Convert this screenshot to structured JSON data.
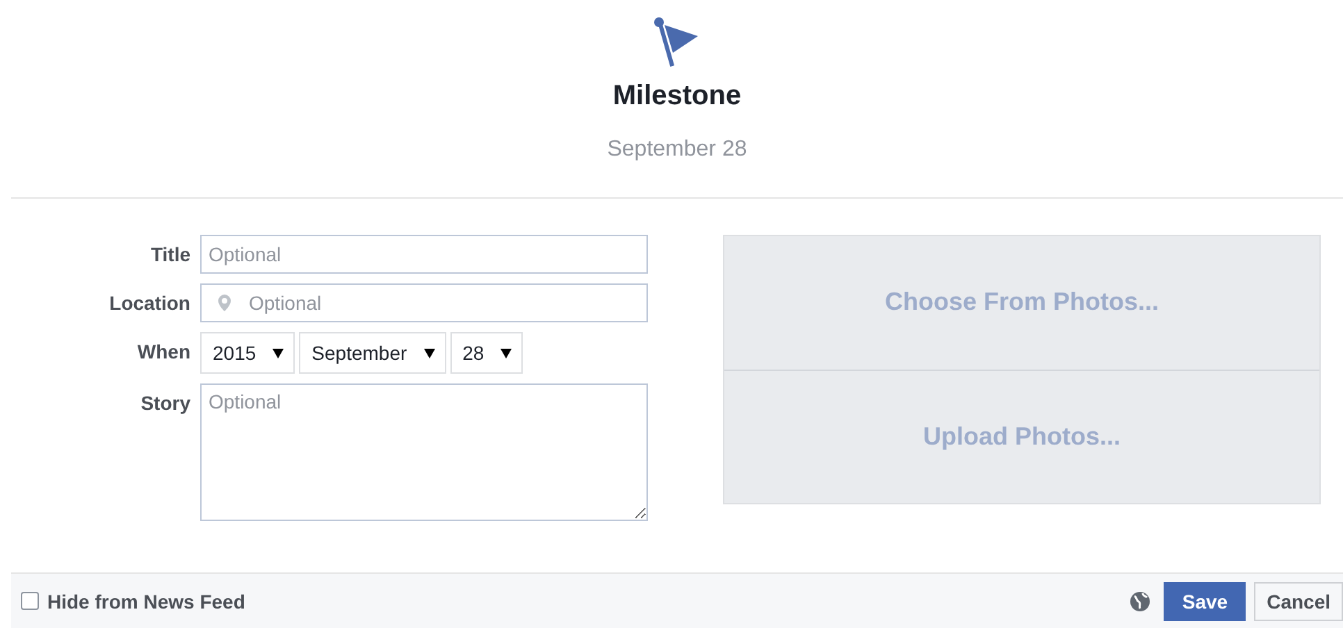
{
  "header": {
    "title": "Milestone",
    "date": "September 28"
  },
  "fields": [
    {
      "kind": "text",
      "label": "Title",
      "placeholder": "Optional"
    },
    {
      "kind": "location",
      "label": "Location",
      "placeholder": "Optional"
    },
    {
      "kind": "date",
      "label": "When",
      "selects": [
        "2015",
        "September",
        "28"
      ]
    },
    {
      "kind": "textarea",
      "label": "Story",
      "placeholder": "Optional"
    }
  ],
  "photo_actions": [
    "Choose From Photos...",
    "Upload Photos..."
  ],
  "footer": {
    "hide_label": "Hide from News Feed",
    "hide_checked": false,
    "save": "Save",
    "cancel": "Cancel"
  }
}
